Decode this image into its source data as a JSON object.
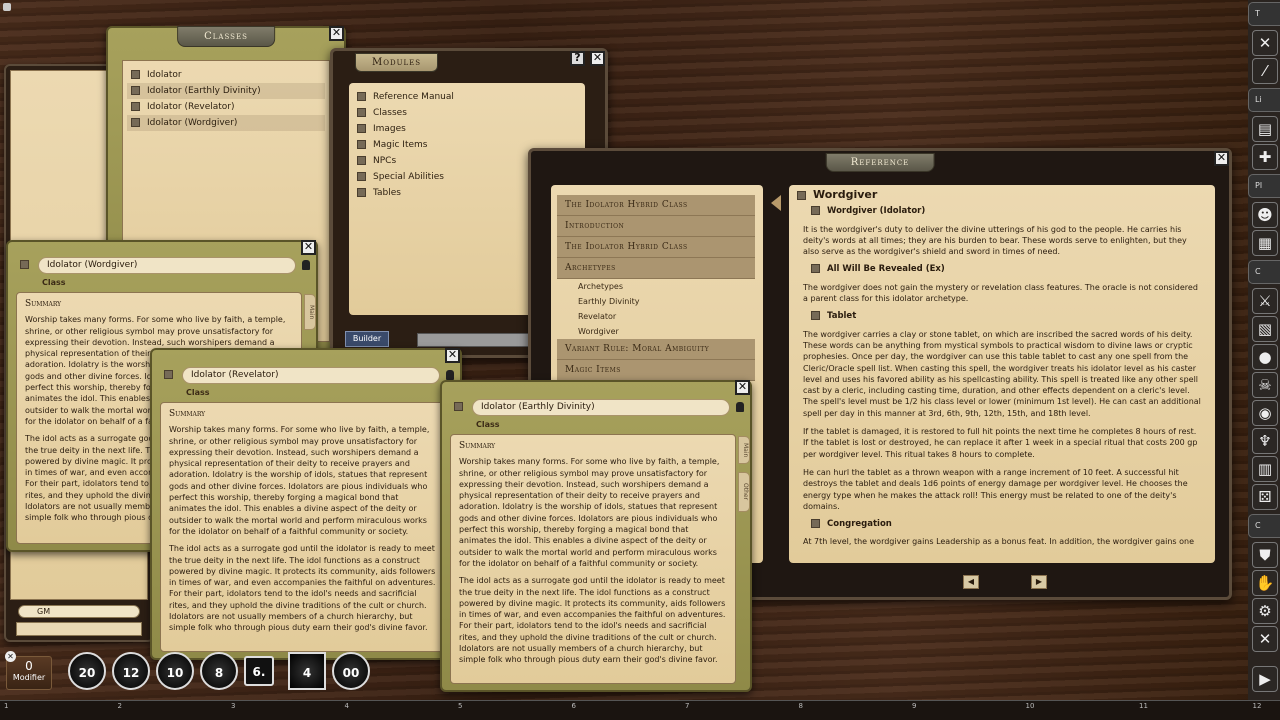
{
  "windows": {
    "classes": {
      "title": "Classes",
      "items": [
        "Idolator",
        "Idolator (Earthly Divinity)",
        "Idolator (Revelator)",
        "Idolator (Wordgiver)"
      ]
    },
    "modules": {
      "title": "Modules",
      "items": [
        "Reference Manual",
        "Classes",
        "Images",
        "Magic Items",
        "NPCs",
        "Special Abilities",
        "Tables"
      ],
      "builder_label": "Builder"
    },
    "reference": {
      "title": "Reference",
      "toc": [
        {
          "t": "h",
          "label": "The Idolator Hybrid Class"
        },
        {
          "t": "h",
          "label": "Introduction"
        },
        {
          "t": "h",
          "label": "The Idolator Hybrid Class"
        },
        {
          "t": "h",
          "label": "Archetypes"
        },
        {
          "t": "s",
          "label": "Archetypes"
        },
        {
          "t": "s",
          "label": "Earthly Divinity"
        },
        {
          "t": "s",
          "label": "Revelator"
        },
        {
          "t": "s",
          "label": "Wordgiver"
        },
        {
          "t": "h",
          "label": "Variant Rule: Moral Ambiguity"
        },
        {
          "t": "h",
          "label": "Magic Items"
        }
      ],
      "heading": "Wordgiver",
      "sub1": "Wordgiver (Idolator)",
      "p1": "It is the wordgiver's duty to deliver the divine utterings of his god to the people. He carries his deity's words at all times; they are his burden to bear. These words serve to enlighten, but they also serve as the wordgiver's shield and sword in times of need.",
      "sub2": "All Will Be Revealed (Ex)",
      "p2": "The wordgiver does not gain the mystery or revelation class features. The oracle is not considered a parent class for this idolator archetype.",
      "sub3": "Tablet",
      "p3": "The wordgiver carries a clay or stone tablet, on which are inscribed the sacred words of his deity. These words can be anything from mystical symbols to practical wisdom to divine laws or cryptic prophesies. Once per day, the wordgiver can use this table tablet to cast any one spell from the Cleric/Oracle spell list. When casting this spell, the wordgiver treats his idolator level as his caster level and uses his favored ability as his spellcasting ability. This spell is treated like any other spell cast by a cleric, including casting time, duration, and other effects dependent on a cleric's level. The spell's level must be 1/2 his class level or lower (minimum 1st level). He can cast an additional spell per day in this manner at 3rd, 6th, 9th, 12th, 15th, and 18th level.",
      "p4": "If the tablet is damaged, it is restored to full hit points the next time he completes 8 hours of rest. If the tablet is lost or destroyed, he can replace it after 1 week in a special ritual that costs 200 gp per wordgiver level. This ritual takes 8 hours to complete.",
      "p5": "He can hurl the tablet as a thrown weapon with a range increment of 10 feet. A successful hit destroys the tablet and deals 1d6 points of energy damage per wordgiver level. He chooses the energy type when he makes the attack roll! This energy must be related to one of the deity's domains.",
      "sub4": "Congregation",
      "p6": "At 7th level, the wordgiver gains Leadership as a bonus feat. In addition, the wordgiver gains one"
    },
    "sheet_wordgiver": {
      "name": "Idolator (Wordgiver)"
    },
    "sheet_revelator": {
      "name": "Idolator (Revelator)"
    },
    "sheet_earthly": {
      "name": "Idolator (Earthly Divinity)"
    },
    "sheet_common": {
      "class_label": "Class",
      "summary_heading": "Summary",
      "tab_main": "Main",
      "tab_other": "Other",
      "p1": "Worship takes many forms. For some who live by faith, a temple, shrine, or other religious symbol may prove unsatisfactory for expressing their devotion. Instead, such worshipers demand a physical representation of their deity to receive prayers and adoration. Idolatry is the worship of idols, statues that represent gods and other divine forces. Idolators are pious individuals who perfect this worship, thereby forging a magical bond that animates the idol. This enables a divine aspect of the deity or outsider to walk the mortal world and perform miraculous works for the idolator on behalf of a faithful community or society.",
      "p2": "The idol acts as a surrogate god until the idolator is ready to meet the true deity in the next life. The idol functions as a construct powered by divine magic. It protects its community, aids followers in times of war, and even accompanies the faithful on adventures. For their part, idolators tend to the idol's needs and sacrificial rites, and they uphold the divine traditions of the cult or church. Idolators are not usually members of a church hierarchy, but simple folk who through pious duty earn their god's divine favor."
    }
  },
  "chat": {
    "identity": "GM"
  },
  "modifier": {
    "value": "0",
    "label": "Modifier"
  },
  "dice": [
    "20",
    "12",
    "10",
    "8",
    "6.",
    "4",
    "00"
  ],
  "ruler": [
    "1",
    "2",
    "3",
    "4",
    "5",
    "6",
    "7",
    "8",
    "9",
    "10",
    "11",
    "12"
  ],
  "sidebar": {
    "headers": [
      "T",
      "Li",
      "Pl",
      "C",
      "C"
    ]
  }
}
